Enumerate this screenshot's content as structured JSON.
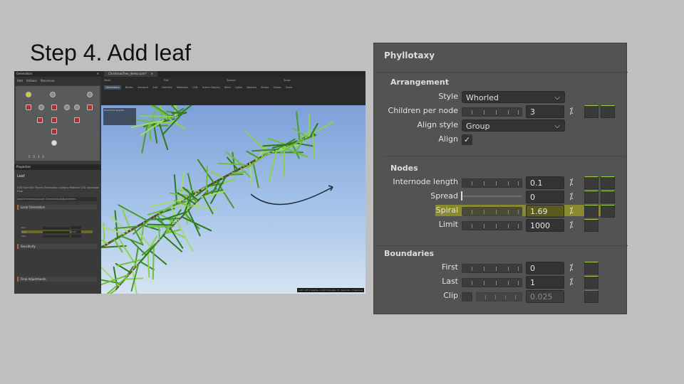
{
  "slide": {
    "title": "Step 4. Add leaf"
  },
  "left_screenshot": {
    "generator_panel": {
      "title": "Generators",
      "tools": [
        "Add",
        "Actions",
        "Recursive"
      ],
      "stats": [
        "5",
        "0",
        "3",
        "3"
      ]
    },
    "properties_panel": {
      "title": "Properties",
      "node_name": "Leaf",
      "tabs": "LOD  Size  Skin  Forces  Orientation  Lighting  Material  LOD  Animation  Final",
      "path": "Leaf/Orientation/Local Orientation/Adjustments",
      "sections": [
        "Local Orientation",
        "Sensitivity",
        "Final Adjustments"
      ],
      "rows": [
        {
          "label": "Roll",
          "value": ""
        },
        {
          "label": "Align",
          "value": "0.00"
        },
        {
          "label": "Yaw",
          "value": ""
        }
      ]
    },
    "document_tab": "ChristmasTree_demo.spm*",
    "toolbar": {
      "groups": [
        "Mode",
        "Edit",
        "Spacial",
        "Show"
      ],
      "buttons": [
        "Generators",
        "Nodes",
        "Interpret",
        "Add",
        "Visibility",
        "Materials",
        "LOD",
        "Scene Objects",
        "Wind",
        "Lights",
        "Nearest",
        "Shows",
        "Shows",
        "Done"
      ],
      "active": "Generators"
    },
    "viewport": {
      "overlay": "Wireframe  Shaded",
      "stats": "LOD: 3/3 triangles, 1,092 triangles, 71 materials, 3 textures"
    }
  },
  "phyllotaxy": {
    "title": "Phyllotaxy",
    "arrangement": {
      "title": "Arrangement",
      "style_label": "Style",
      "style_value": "Whorled",
      "children_label": "Children per node",
      "children_value": "3",
      "align_style_label": "Align style",
      "align_style_value": "Group",
      "align_label": "Align",
      "align_checked": true
    },
    "nodes": {
      "title": "Nodes",
      "rows": [
        {
          "label": "Internode length",
          "value": "0.1"
        },
        {
          "label": "Spread",
          "value": "0"
        },
        {
          "label": "Spiral",
          "value": "1.69"
        },
        {
          "label": "Limit",
          "value": "1000"
        }
      ]
    },
    "boundaries": {
      "title": "Boundaries",
      "rows": [
        {
          "label": "First",
          "value": "0"
        },
        {
          "label": "Last",
          "value": "1"
        },
        {
          "label": "Clip",
          "value": "0.025"
        }
      ]
    },
    "random_icon": "percent-random-icon",
    "highlight_color": "#cdcd00"
  }
}
